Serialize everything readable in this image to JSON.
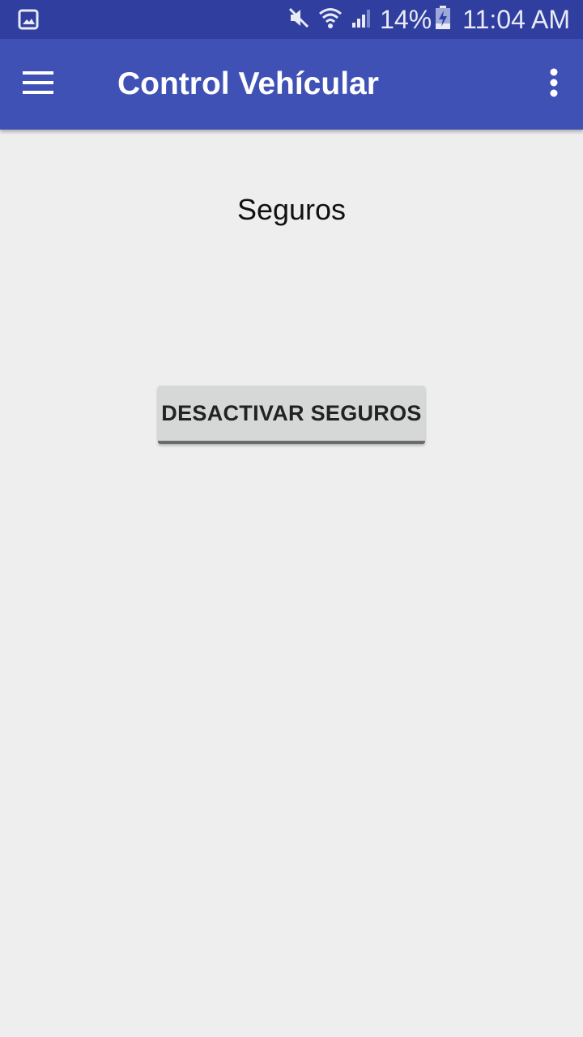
{
  "status_bar": {
    "battery_percent": "14%",
    "time": "11:04 AM",
    "icons": [
      "image-notification-icon",
      "mute-icon",
      "wifi-icon",
      "signal-icon",
      "battery-charging-icon"
    ]
  },
  "app_bar": {
    "title": "Control Vehícular",
    "menu_icon": "hamburger-menu-icon",
    "overflow_icon": "more-vert-icon",
    "color": "#3f51b5"
  },
  "content": {
    "section_label": "Seguros",
    "action_button_label": "DESACTIVAR SEGUROS"
  },
  "colors": {
    "status_bar": "#303f9f",
    "app_bar": "#3f51b5",
    "background": "#eeeeee",
    "button": "#d6d7d7"
  }
}
